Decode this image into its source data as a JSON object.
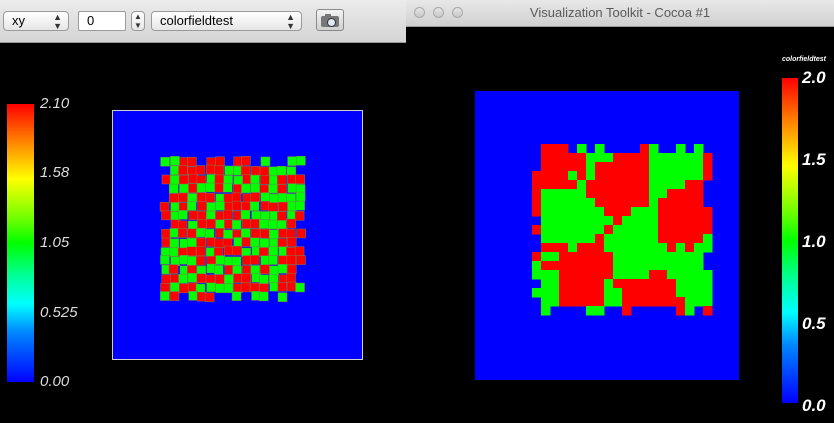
{
  "left_window": {
    "toolbar": {
      "view_select": "xy",
      "slice_value": "0",
      "field_select": "colorfieldtest"
    },
    "colorbar": {
      "ticks": [
        "2.10",
        "1.58",
        "1.05",
        "0.525",
        "0.00"
      ]
    }
  },
  "right_window": {
    "title": "Visualization Toolkit - Cocoa #1",
    "colorbar": {
      "title": "colorfieldtest",
      "ticks": [
        "2.0",
        "1.5",
        "1.0",
        "0.5",
        "0.0"
      ]
    }
  },
  "colors": {
    "background": "#000000",
    "field_blue": "#0000ff",
    "cell_red": "#ff0000",
    "cell_green": "#00ff00"
  }
}
